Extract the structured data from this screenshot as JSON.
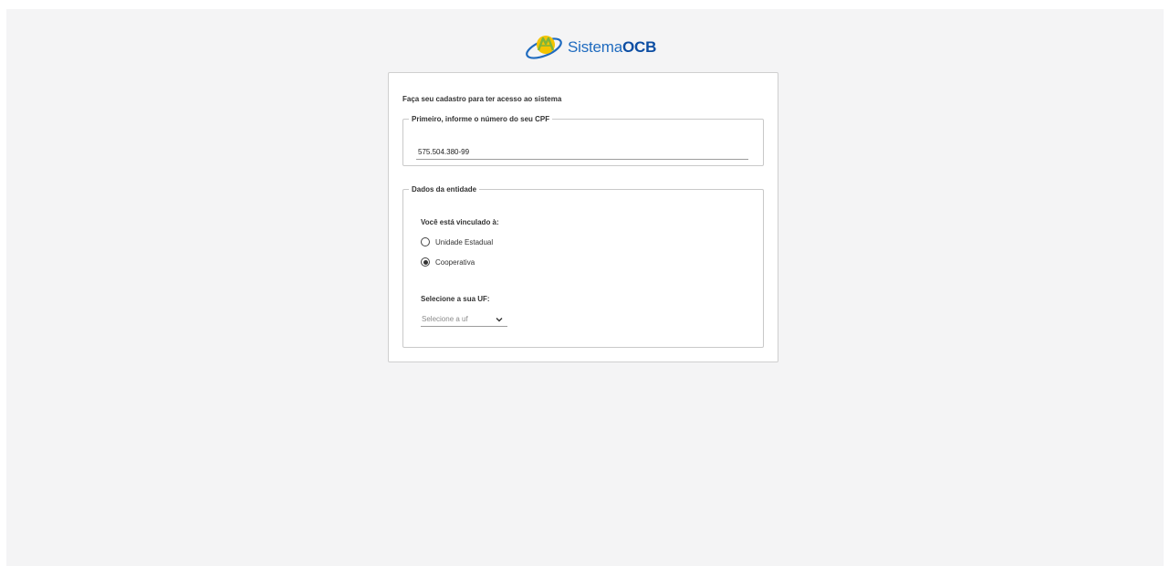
{
  "brand": {
    "name_light": "Sistema",
    "name_bold": "OCB",
    "colors": {
      "blue": "#1f6bbf",
      "yellow": "#f4c400",
      "green": "#7fb53a"
    }
  },
  "form": {
    "intro": "Faça seu cadastro para ter acesso ao sistema",
    "cpf_section": {
      "legend": "Primeiro, informe o número do seu CPF",
      "value": "575.504.380-99"
    },
    "entity_section": {
      "legend": "Dados da entidade",
      "question": "Você está vinculado à:",
      "options": [
        {
          "label": "Unidade Estadual",
          "selected": false
        },
        {
          "label": "Cooperativa",
          "selected": true
        }
      ],
      "uf_label": "Selecione a sua UF:",
      "uf_placeholder": "Selecione a uf",
      "uf_icon": "chevron-down-icon"
    }
  }
}
